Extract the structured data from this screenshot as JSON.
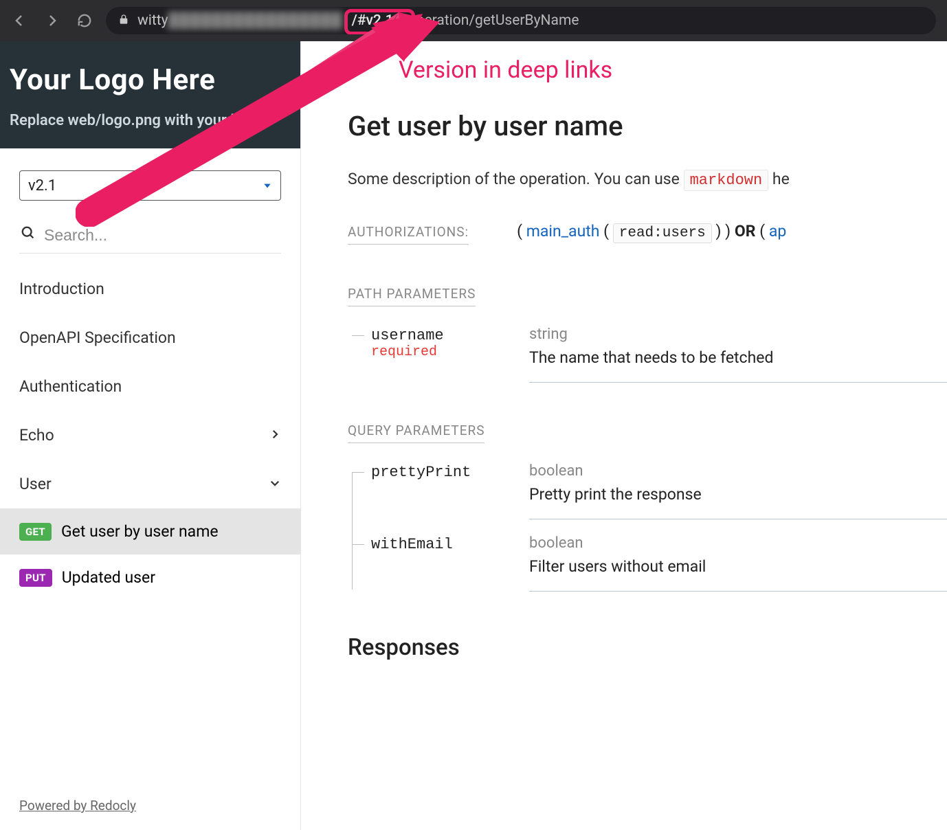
{
  "browser": {
    "url_prefix": "witty",
    "url_blurred": "████████████████",
    "url_highlight": "/#v2.1/",
    "url_after_highlight_prefix": "o",
    "url_suffix": "peration/getUserByName"
  },
  "annotation": {
    "label": "Version in deep links"
  },
  "logo": {
    "title": "Your  Logo Here",
    "subtitle": "Replace web/logo.png with your logo"
  },
  "version_select": "v2.1",
  "search": {
    "placeholder": "Search..."
  },
  "nav": {
    "items": [
      {
        "label": "Introduction"
      },
      {
        "label": "OpenAPI Specification"
      },
      {
        "label": "Authentication"
      },
      {
        "label": "Echo",
        "chevron": "right"
      },
      {
        "label": "User",
        "chevron": "down"
      }
    ],
    "user_children": [
      {
        "method": "GET",
        "label": "Get user by user name",
        "active": true
      },
      {
        "method": "PUT",
        "label": "Updated user",
        "active": false
      }
    ]
  },
  "powered": "Powered by Redocly",
  "content": {
    "title": "Get user by user name",
    "description_pre": "Some description of the operation. You can use ",
    "description_code": "markdown",
    "description_post": " he",
    "auth_label": "AUTHORIZATIONS:",
    "auth": {
      "open1": "( ",
      "main": "main_auth",
      "open2": " ( ",
      "scope": "read:users",
      "close2": " ) )",
      "or": " OR ",
      "open3": "( ",
      "api": "ap"
    },
    "path_label": "PATH PARAMETERS",
    "path_params": [
      {
        "name": "username",
        "required": "required",
        "type": "string",
        "desc": "The name that needs to be fetched"
      }
    ],
    "query_label": "QUERY PARAMETERS",
    "query_params": [
      {
        "name": "prettyPrint",
        "type": "boolean",
        "desc": "Pretty print the response"
      },
      {
        "name": "withEmail",
        "type": "boolean",
        "desc": "Filter users without email"
      }
    ],
    "responses_label": "Responses"
  }
}
